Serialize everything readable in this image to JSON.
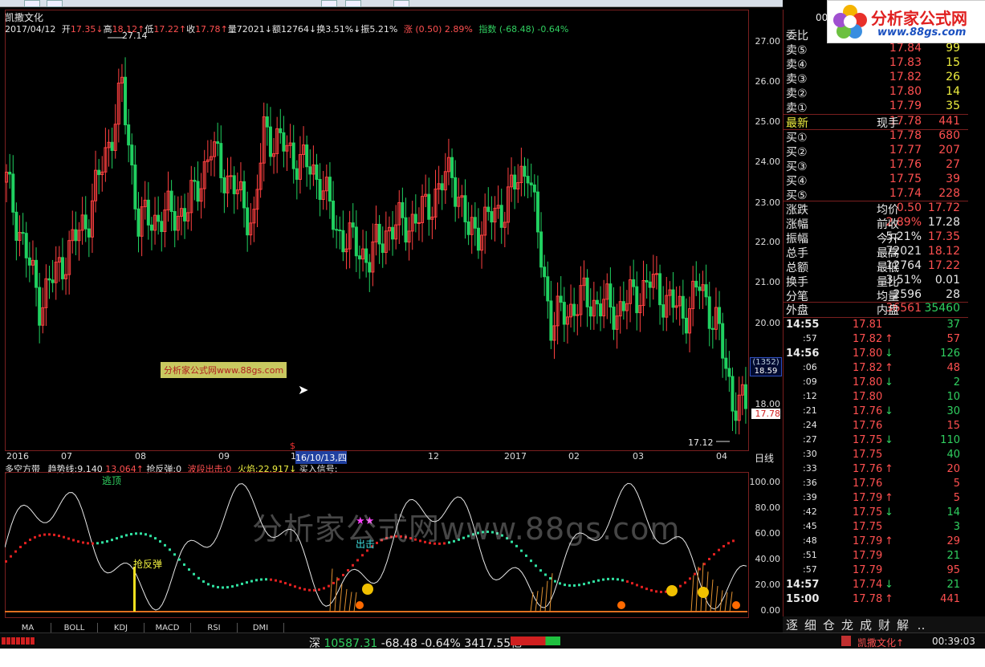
{
  "header": {
    "stock_name": "凯撒文化",
    "date": "2017/04/12",
    "open_label": "开",
    "open_val": "17.35",
    "high_label": "高",
    "high_val": "18.12",
    "low_label": "低",
    "low_val": "17.22",
    "close_label": "收",
    "close_val": "17.78",
    "vol_label": "量",
    "vol_val": "72021",
    "amt_label": "额",
    "amt_val": "12764",
    "turn_label": "换",
    "turn_val": "3.51%",
    "amp_label": "振",
    "amp_val": "5.21%",
    "chg_text": "涨 (0.50) 2.89%",
    "idx_text": "指数 (-68.48) -0.64%",
    "code_fragment": "00"
  },
  "chart": {
    "high_marker": "27.14",
    "low_marker": "17.12",
    "price_ticks": [
      "27.00",
      "26.00",
      "25.00",
      "24.00",
      "23.00",
      "22.00",
      "21.00",
      "20.00",
      "18.00"
    ],
    "cursor_box": "(1352)",
    "cursor_price": "18.59",
    "last_price_tag": "17.78",
    "watermark_small": "分析家公式网www.88gs.com",
    "watermark_big": "分析家公式网www.88gs.com",
    "dates": [
      "2016",
      "07",
      "08",
      "09",
      "10",
      "16/10/13,四",
      "12",
      "2017",
      "02",
      "03",
      "04"
    ],
    "period": "日线"
  },
  "indicator": {
    "name": "多空方带",
    "trend_label": "趋势线:9.140",
    "trend_val2": "13.064",
    "qfd": "抢反弹:0",
    "bdcj": "波段出击:0",
    "hy": "火焰:22.917",
    "buy": "买入信号:",
    "label_top": "逃顶",
    "label_rebound": "抢反弹",
    "label_attack": "出击",
    "stars": "★★",
    "ticks": [
      "100.00",
      "80.00",
      "60.00",
      "40.00",
      "20.00",
      "0.00"
    ]
  },
  "indicator_tabs": [
    "MA",
    "BOLL",
    "KDJ",
    "MACD",
    "RSI",
    "DMI"
  ],
  "orderbook": {
    "title": "委比",
    "sells": [
      {
        "label": "卖⑤",
        "price": "17.84",
        "qty": "99"
      },
      {
        "label": "卖④",
        "price": "17.83",
        "qty": "15"
      },
      {
        "label": "卖③",
        "price": "17.82",
        "qty": "26"
      },
      {
        "label": "卖②",
        "price": "17.80",
        "qty": "14"
      },
      {
        "label": "卖①",
        "price": "17.79",
        "qty": "35"
      }
    ],
    "latest": {
      "label": "最新",
      "price": "17.78",
      "label2": "现手",
      "qty": "441"
    },
    "buys": [
      {
        "label": "买①",
        "price": "17.78",
        "qty": "680"
      },
      {
        "label": "买②",
        "price": "17.77",
        "qty": "207"
      },
      {
        "label": "买③",
        "price": "17.76",
        "qty": "27"
      },
      {
        "label": "买④",
        "price": "17.75",
        "qty": "39"
      },
      {
        "label": "买⑤",
        "price": "17.74",
        "qty": "228"
      }
    ]
  },
  "stats": [
    {
      "l": "涨跌",
      "v": "0.50",
      "l2": "均价",
      "v2": "17.72",
      "vc": "red",
      "v2c": "red"
    },
    {
      "l": "涨幅",
      "v": "2.89%",
      "l2": "前收",
      "v2": "17.28",
      "vc": "red",
      "v2c": "white"
    },
    {
      "l": "振幅",
      "v": "5.21%",
      "l2": "今开",
      "v2": "17.35",
      "vc": "white",
      "v2c": "red"
    },
    {
      "l": "总手",
      "v": "72021",
      "l2": "最高",
      "v2": "18.12",
      "vc": "white",
      "v2c": "red"
    },
    {
      "l": "总额",
      "v": "12764",
      "l2": "最低",
      "v2": "17.22",
      "vc": "white",
      "v2c": "red"
    },
    {
      "l": "换手",
      "v": "3.51%",
      "l2": "量比",
      "v2": "0.01",
      "vc": "white",
      "v2c": "white"
    },
    {
      "l": "分笔",
      "v": "2596",
      "l2": "均量",
      "v2": "28",
      "vc": "white",
      "v2c": "white"
    }
  ],
  "outer_inner": {
    "l": "外盘",
    "v": "36561",
    "l2": "内盘",
    "v2": "35460"
  },
  "ticks": [
    {
      "t": "14:55",
      "p": "17.81",
      "a": "",
      "q": "37",
      "qc": "green"
    },
    {
      "t": ":57",
      "p": "17.82",
      "a": "↑",
      "q": "57",
      "qc": "red"
    },
    {
      "t": "14:56",
      "p": "17.80",
      "a": "↓",
      "q": "126",
      "qc": "green"
    },
    {
      "t": ":06",
      "p": "17.82",
      "a": "↑",
      "q": "48",
      "qc": "red"
    },
    {
      "t": ":09",
      "p": "17.80",
      "a": "↓",
      "q": "2",
      "qc": "green"
    },
    {
      "t": ":12",
      "p": "17.80",
      "a": "",
      "q": "10",
      "qc": "green"
    },
    {
      "t": ":21",
      "p": "17.76",
      "a": "↓",
      "q": "30",
      "qc": "green"
    },
    {
      "t": ":24",
      "p": "17.76",
      "a": "",
      "q": "15",
      "qc": "red"
    },
    {
      "t": ":27",
      "p": "17.75",
      "a": "↓",
      "q": "110",
      "qc": "green"
    },
    {
      "t": ":30",
      "p": "17.75",
      "a": "",
      "q": "40",
      "qc": "green"
    },
    {
      "t": ":33",
      "p": "17.76",
      "a": "↑",
      "q": "20",
      "qc": "red"
    },
    {
      "t": ":36",
      "p": "17.76",
      "a": "",
      "q": "5",
      "qc": "red"
    },
    {
      "t": ":39",
      "p": "17.79",
      "a": "↑",
      "q": "5",
      "qc": "red"
    },
    {
      "t": ":42",
      "p": "17.75",
      "a": "↓",
      "q": "14",
      "qc": "green"
    },
    {
      "t": ":45",
      "p": "17.75",
      "a": "",
      "q": "3",
      "qc": "green"
    },
    {
      "t": ":48",
      "p": "17.79",
      "a": "↑",
      "q": "29",
      "qc": "red"
    },
    {
      "t": ":51",
      "p": "17.79",
      "a": "",
      "q": "21",
      "qc": "green"
    },
    {
      "t": ":57",
      "p": "17.79",
      "a": "",
      "q": "95",
      "qc": "red"
    },
    {
      "t": "14:57",
      "p": "17.74",
      "a": "↓",
      "q": "21",
      "qc": "green"
    },
    {
      "t": "15:00",
      "p": "17.78",
      "a": "↑",
      "q": "441",
      "qc": "red"
    }
  ],
  "bottom_tabs": [
    "逐",
    "细",
    "仓",
    "龙",
    "成",
    "财",
    "解",
    "‥"
  ],
  "status": {
    "market": "深",
    "index_val": "10587.31",
    "index_chg": "-68.48",
    "index_pct": "-0.64%",
    "amount": "3417.55亿",
    "stock_tag": "凯撒文化↑",
    "clock": "00:39:03"
  },
  "logo": {
    "text": "分析家公式网",
    "url": "www.88gs.com"
  },
  "colors": {
    "up": "#ff4040",
    "down": "#20d060",
    "frame": "#7a1f1f"
  }
}
